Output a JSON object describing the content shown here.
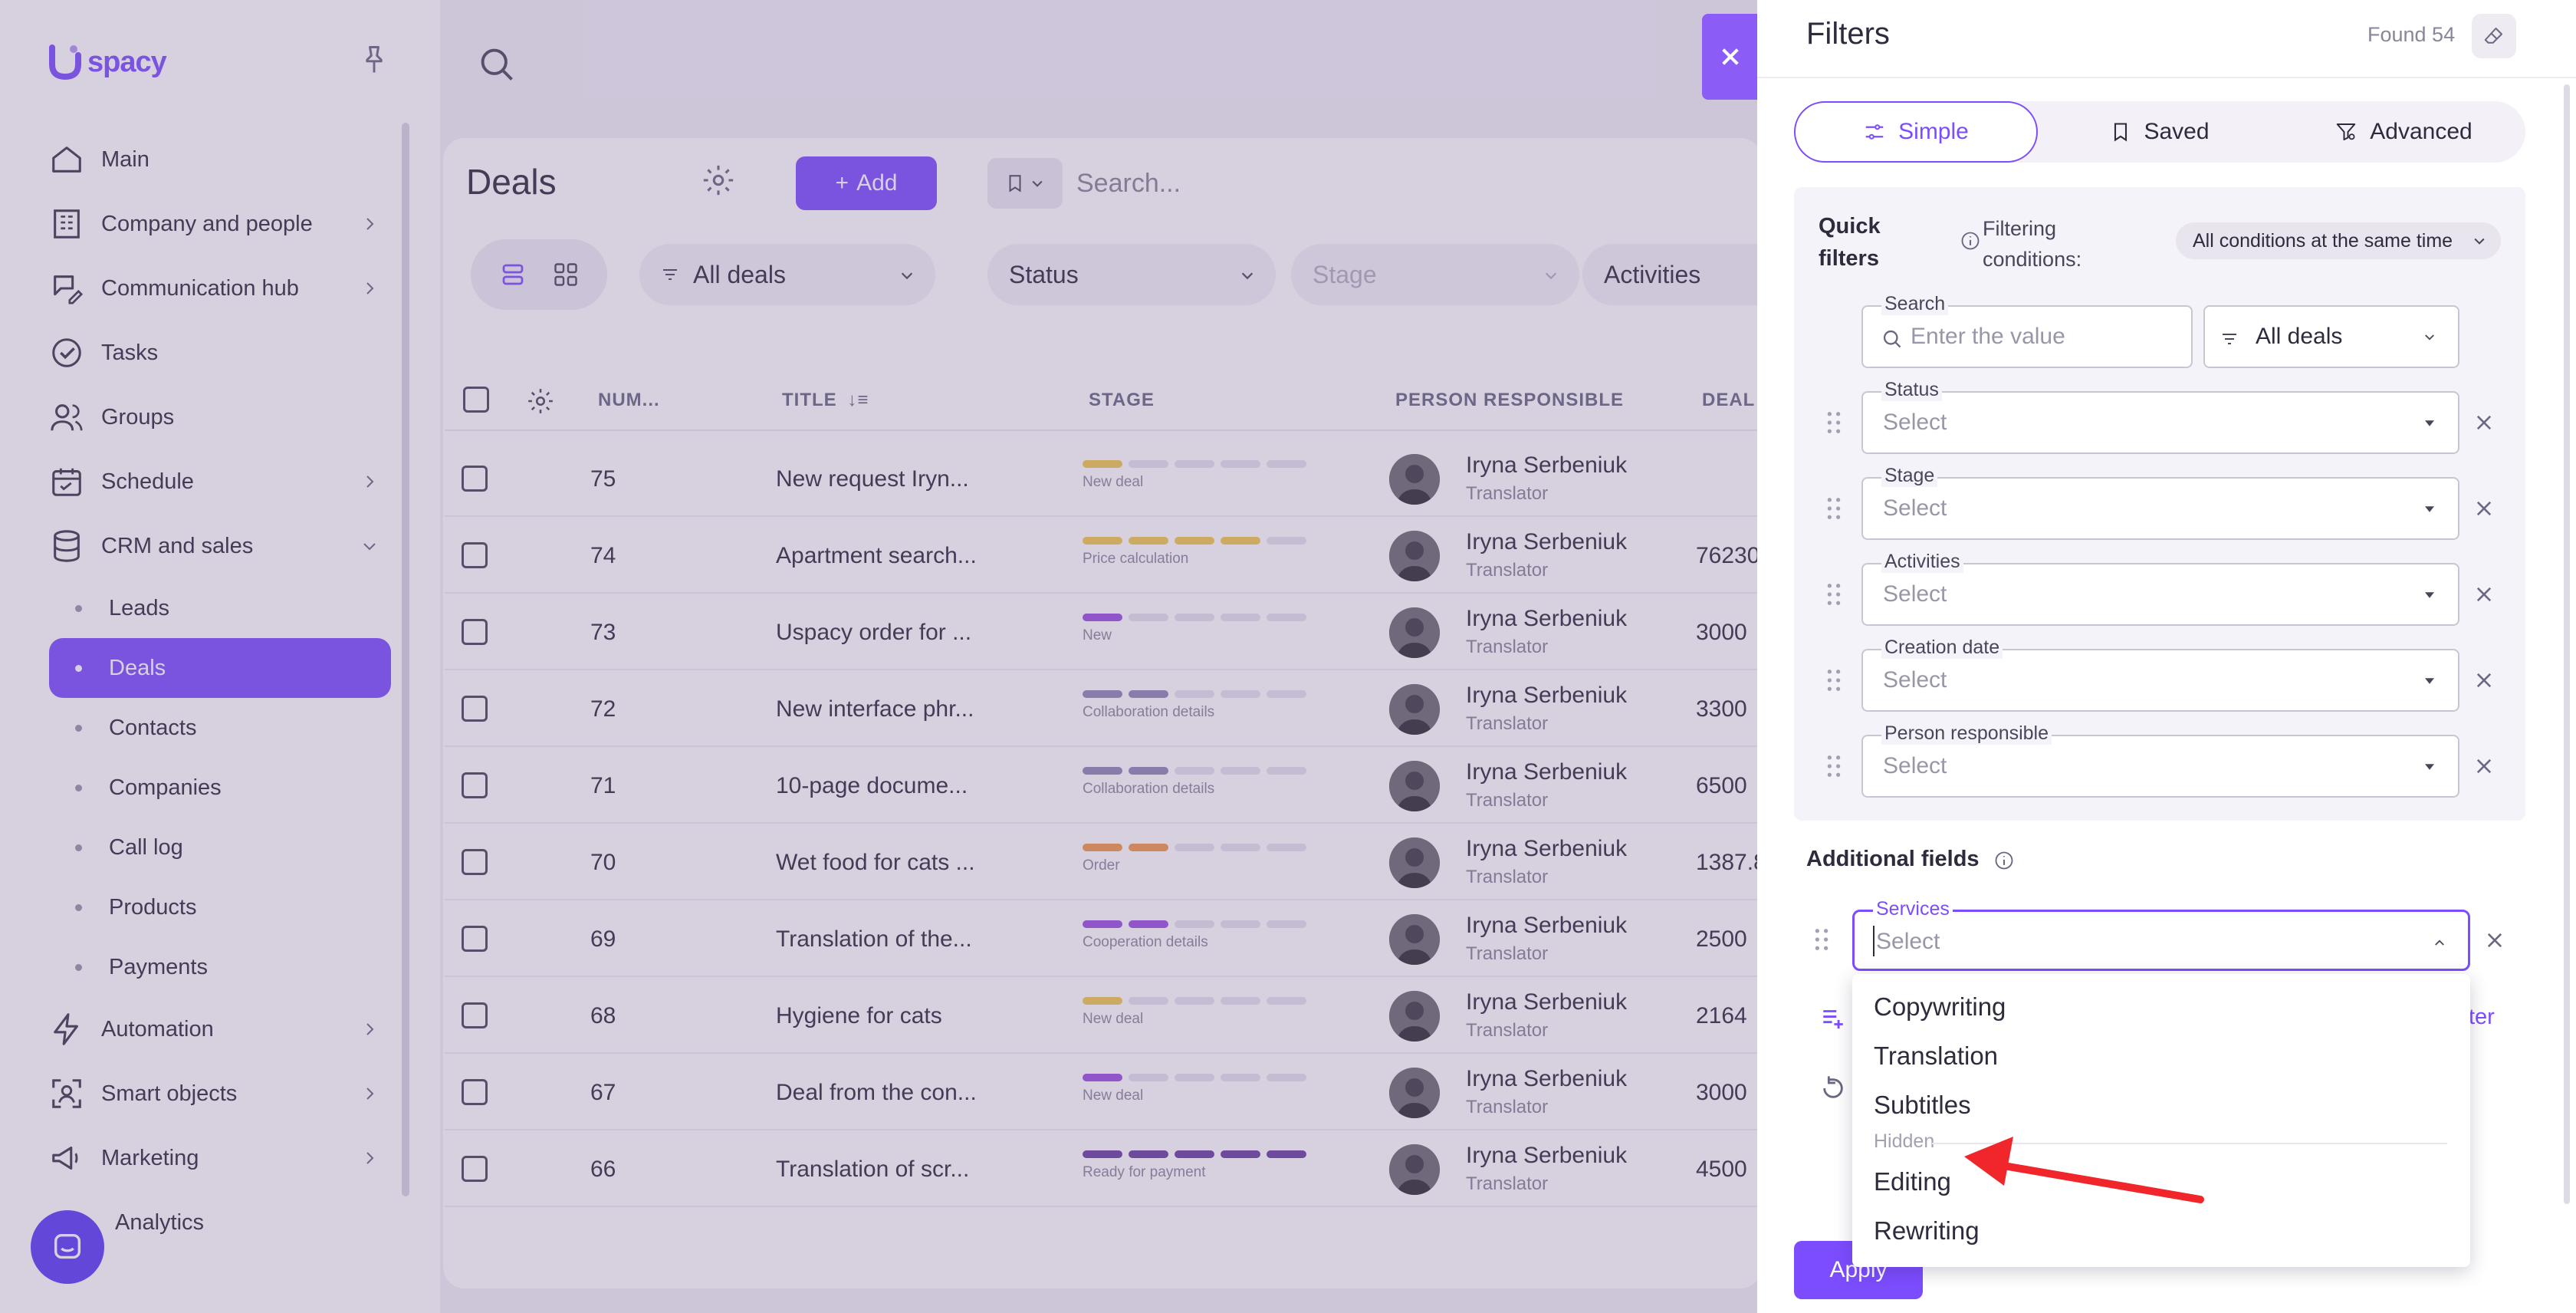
{
  "app": {
    "brand": "Uspacy",
    "accent": "#7c4dff"
  },
  "sidebar": {
    "items": [
      {
        "label": "Main",
        "icon": "home-icon"
      },
      {
        "label": "Company and people",
        "icon": "building-icon",
        "expandable": true
      },
      {
        "label": "Communication hub",
        "icon": "chat-edit-icon",
        "expandable": true
      },
      {
        "label": "Tasks",
        "icon": "check-circle-icon"
      },
      {
        "label": "Groups",
        "icon": "users-icon"
      },
      {
        "label": "Schedule",
        "icon": "calendar-icon",
        "expandable": true
      },
      {
        "label": "CRM and sales",
        "icon": "database-icon",
        "expanded": true
      }
    ],
    "crm_sub": [
      "Leads",
      "Deals",
      "Contacts",
      "Companies",
      "Call log",
      "Products",
      "Payments"
    ],
    "active_sub": "Deals",
    "bottom_items": [
      {
        "label": "Automation",
        "icon": "lightning-icon"
      },
      {
        "label": "Smart objects",
        "icon": "smart-object-icon"
      },
      {
        "label": "Marketing",
        "icon": "megaphone-icon"
      },
      {
        "label": "Analytics",
        "icon": "chart-icon"
      }
    ]
  },
  "main": {
    "title": "Deals",
    "add_label": "Add",
    "search_placeholder": "Search...",
    "view_filter": "All deals",
    "filters": [
      "Status",
      "Stage",
      "Activities"
    ],
    "columns": [
      "NUM...",
      "TITLE",
      "STAGE",
      "PERSON RESPONSIBLE",
      "DEAL"
    ],
    "rows": [
      {
        "num": "75",
        "title": "New request Iryn...",
        "stage": "New deal",
        "bars": 1,
        "bar_color": "#f2c94c",
        "person": "Iryna Serbeniuk",
        "role": "Translator",
        "amount": ""
      },
      {
        "num": "74",
        "title": "Apartment search...",
        "stage": "Price calculation",
        "bars": 4,
        "bar_color": "#f2c94c",
        "person": "Iryna Serbeniuk",
        "role": "Translator",
        "amount": "76230"
      },
      {
        "num": "73",
        "title": "Uspacy order for ...",
        "stage": "New",
        "bars": 1,
        "bar_color": "#9b51e0",
        "person": "Iryna Serbeniuk",
        "role": "Translator",
        "amount": "3000"
      },
      {
        "num": "72",
        "title": "New interface phr...",
        "stage": "Collaboration details",
        "bars": 2,
        "bar_color": "#8e87b5",
        "person": "Iryna Serbeniuk",
        "role": "Translator",
        "amount": "3300"
      },
      {
        "num": "71",
        "title": "10-page docume...",
        "stage": "Collaboration details",
        "bars": 2,
        "bar_color": "#8e87b5",
        "person": "Iryna Serbeniuk",
        "role": "Translator",
        "amount": "6500"
      },
      {
        "num": "70",
        "title": "Wet food for cats ...",
        "stage": "Order",
        "bars": 2,
        "bar_color": "#f2994a",
        "person": "Iryna Serbeniuk",
        "role": "Translator",
        "amount": "1387.8"
      },
      {
        "num": "69",
        "title": "Translation of the...",
        "stage": "Cooperation details",
        "bars": 2,
        "bar_color": "#9b51e0",
        "person": "Iryna Serbeniuk",
        "role": "Translator",
        "amount": "2500"
      },
      {
        "num": "68",
        "title": "Hygiene for cats",
        "stage": "New deal",
        "bars": 1,
        "bar_color": "#f2c94c",
        "person": "Iryna Serbeniuk",
        "role": "Translator",
        "amount": "2164"
      },
      {
        "num": "67",
        "title": "Deal from the con...",
        "stage": "New deal",
        "bars": 1,
        "bar_color": "#9b51e0",
        "person": "Iryna Serbeniuk",
        "role": "Translator",
        "amount": "3000"
      },
      {
        "num": "66",
        "title": "Translation of scr...",
        "stage": "Ready for payment",
        "bars": 5,
        "bar_color": "#6b3fa0",
        "person": "Iryna Serbeniuk",
        "role": "Translator",
        "amount": "4500"
      }
    ]
  },
  "panel": {
    "title": "Filters",
    "found": "Found 54",
    "tabs": [
      "Simple",
      "Saved",
      "Advanced"
    ],
    "active_tab": "Simple",
    "quick_filters_title": "Quick filters",
    "filtering_conditions_label": "Filtering conditions:",
    "condition_value": "All conditions at the same time",
    "search_label": "Search",
    "search_placeholder": "Enter the value",
    "deals_select": "All deals",
    "fields": [
      {
        "label": "Status",
        "value": "Select"
      },
      {
        "label": "Stage",
        "value": "Select"
      },
      {
        "label": "Activities",
        "value": "Select"
      },
      {
        "label": "Creation date",
        "value": "Select"
      },
      {
        "label": "Person responsible",
        "value": "Select"
      }
    ],
    "additional_title": "Additional fields",
    "services_label": "Services",
    "services_placeholder": "Select",
    "options": [
      "Copywriting",
      "Translation",
      "Subtitles"
    ],
    "hidden_group_label": "Hidden",
    "hidden_options": [
      "Editing",
      "Rewriting"
    ],
    "side_link_fragment": "ter",
    "apply_label": "Apply"
  }
}
